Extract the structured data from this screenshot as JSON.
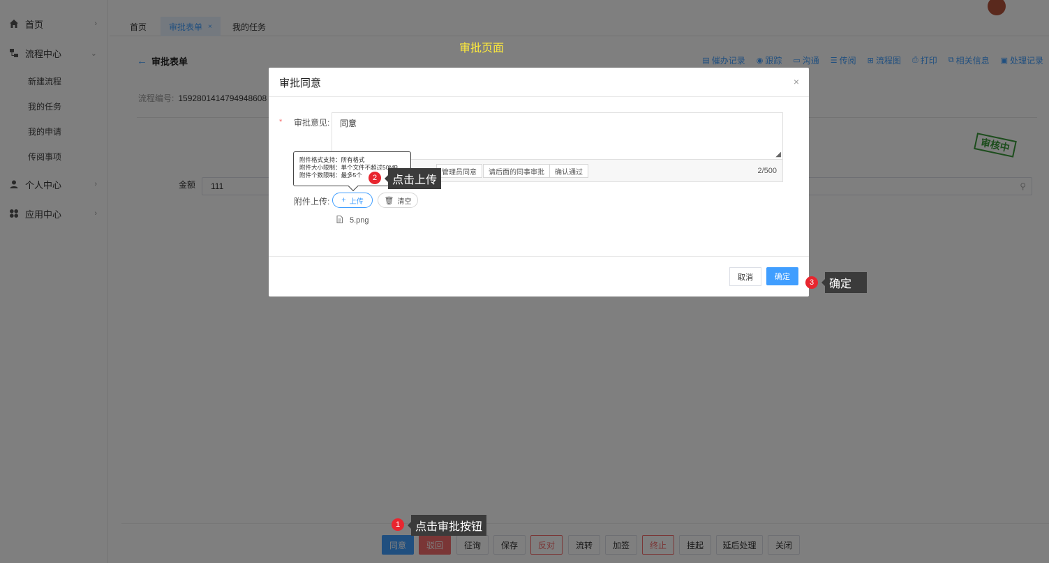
{
  "sidebar": {
    "items": [
      {
        "label": "首页",
        "icon": "home-icon"
      },
      {
        "label": "流程中心",
        "icon": "flow-icon"
      },
      {
        "label": "个人中心",
        "icon": "person-icon"
      },
      {
        "label": "应用中心",
        "icon": "apps-icon"
      }
    ],
    "sub_items": [
      "新建流程",
      "我的任务",
      "我的申请",
      "传阅事项"
    ]
  },
  "tabs": [
    {
      "label": "首页"
    },
    {
      "label": "审批表单",
      "close": "×"
    },
    {
      "label": "我的任务"
    }
  ],
  "page": {
    "center_title": "审批页面",
    "back_title": "审批表单",
    "toolbar_links": [
      "催办记录",
      "跟踪",
      "沟通",
      "传阅",
      "流程图",
      "打印",
      "相关信息",
      "处理记录"
    ],
    "process_no_label": "流程编号:",
    "process_no": "1592801414794948608",
    "stamp": "审核中",
    "amount_label": "金额",
    "amount_value": "111"
  },
  "bottom_buttons": [
    {
      "label": "同意",
      "style": "primary"
    },
    {
      "label": "驳回",
      "style": "danger"
    },
    {
      "label": "征询",
      "style": "default"
    },
    {
      "label": "保存",
      "style": "default"
    },
    {
      "label": "反对",
      "style": "danger-outline"
    },
    {
      "label": "流转",
      "style": "default"
    },
    {
      "label": "加签",
      "style": "default"
    },
    {
      "label": "终止",
      "style": "danger-outline"
    },
    {
      "label": "挂起",
      "style": "default"
    },
    {
      "label": "延后处理",
      "style": "default"
    },
    {
      "label": "关闭",
      "style": "default"
    }
  ],
  "dialog": {
    "title": "审批同意",
    "close": "×",
    "opinion_label": "审批意见:",
    "opinion_value": "同意",
    "quick_phrases": [
      "管理员同意",
      "请后面的同事审批",
      "确认通过"
    ],
    "counter": "2/500",
    "attach_label": "附件上传:",
    "upload_label": "上传",
    "clear_label": "清空",
    "file_name": "5.png",
    "cancel_label": "取消",
    "ok_label": "确定"
  },
  "tooltip": {
    "lines": [
      "附件格式支持：所有格式",
      "附件大小限制：单个文件不超过50MB",
      "附件个数限制：最多5个"
    ]
  },
  "annotations": [
    {
      "num": "1",
      "text": "点击审批按钮"
    },
    {
      "num": "2",
      "text": "点击上传"
    },
    {
      "num": "3",
      "text": "确定"
    }
  ],
  "colors": {
    "primary": "#409eff",
    "danger": "#f56c6c",
    "annotation_badge": "#e8262f",
    "center_title": "#ffeb3b"
  }
}
